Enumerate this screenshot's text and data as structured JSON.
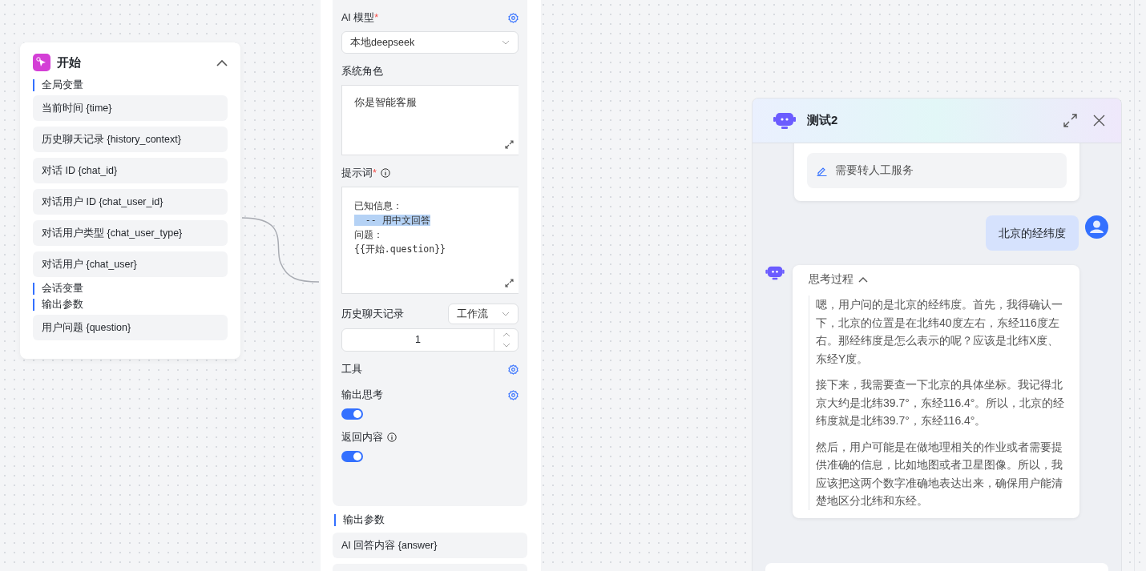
{
  "start_node": {
    "title": "开始",
    "expanded": true,
    "sections": [
      {
        "label": "全局变量",
        "items": [
          "当前时间 {time}",
          "历史聊天记录 {history_context}",
          "对话 ID {chat_id}",
          "对话用户 ID {chat_user_id}",
          "对话用户类型 {chat_user_type}",
          "对话用户 {chat_user}"
        ]
      },
      {
        "label": "会话变量"
      },
      {
        "label": "输出参数",
        "items": [
          "用户问题 {question}"
        ]
      }
    ]
  },
  "llm_node": {
    "fields": [
      {
        "kind": "select",
        "label": "AI 模型",
        "required_mark": "*",
        "info": false,
        "settings": true,
        "value": "本地deepseek"
      },
      {
        "kind": "textarea",
        "label": "系统角色",
        "info": false,
        "settings": false,
        "lines": [
          {
            "text": "你是智能客服",
            "selected": false
          }
        ]
      },
      {
        "kind": "code",
        "label": "提示词",
        "required_mark": "*",
        "info": true,
        "settings": false,
        "lines": [
          {
            "text": "已知信息：",
            "selected": false
          },
          {
            "text": "  -- 用中文回答",
            "selected": true
          },
          {
            "text": "问题：",
            "selected": false
          },
          {
            "text": "{{开始.question}}",
            "selected": false
          }
        ]
      },
      {
        "kind": "history",
        "label": "历史聊天记录",
        "info": false,
        "settings": false,
        "value": "工作流",
        "count": "1"
      },
      {
        "kind": "plain",
        "label": "工具",
        "info": false,
        "settings": true
      },
      {
        "kind": "switch",
        "label": "输出思考",
        "info": false,
        "settings": true,
        "on": true
      },
      {
        "kind": "switch",
        "label": "返回内容",
        "info": true,
        "settings": false,
        "on": true
      }
    ],
    "output_label": "输出参数",
    "outputs": [
      "AI 回答内容 {answer}"
    ]
  },
  "chat": {
    "title": "测试2",
    "messages": [
      {
        "kind": "suggestion",
        "text": "需要转人工服务"
      },
      {
        "kind": "user",
        "text": "北京的经纬度"
      },
      {
        "kind": "thinking",
        "header": "思考过程",
        "expanded": true,
        "paragraphs": [
          "嗯，用户问的是北京的经纬度。首先，我得确认一下，北京的位置是在北纬40度左右，东经116度左右。那经纬度是怎么表示的呢？应该是北纬X度、东经Y度。",
          "接下来，我需要查一下北京的具体坐标。我记得北京大约是北纬39.7°，东经116.4°。所以，北京的经纬度就是北纬39.7°，东经116.4°。",
          "然后，用户可能是在做地理相关的作业或者需要提供准确的信息，比如地图或者卫星图像。所以，我应该把这两个数字准确地表达出来，确保用户能清楚地区分北纬和东经。"
        ]
      }
    ]
  }
}
